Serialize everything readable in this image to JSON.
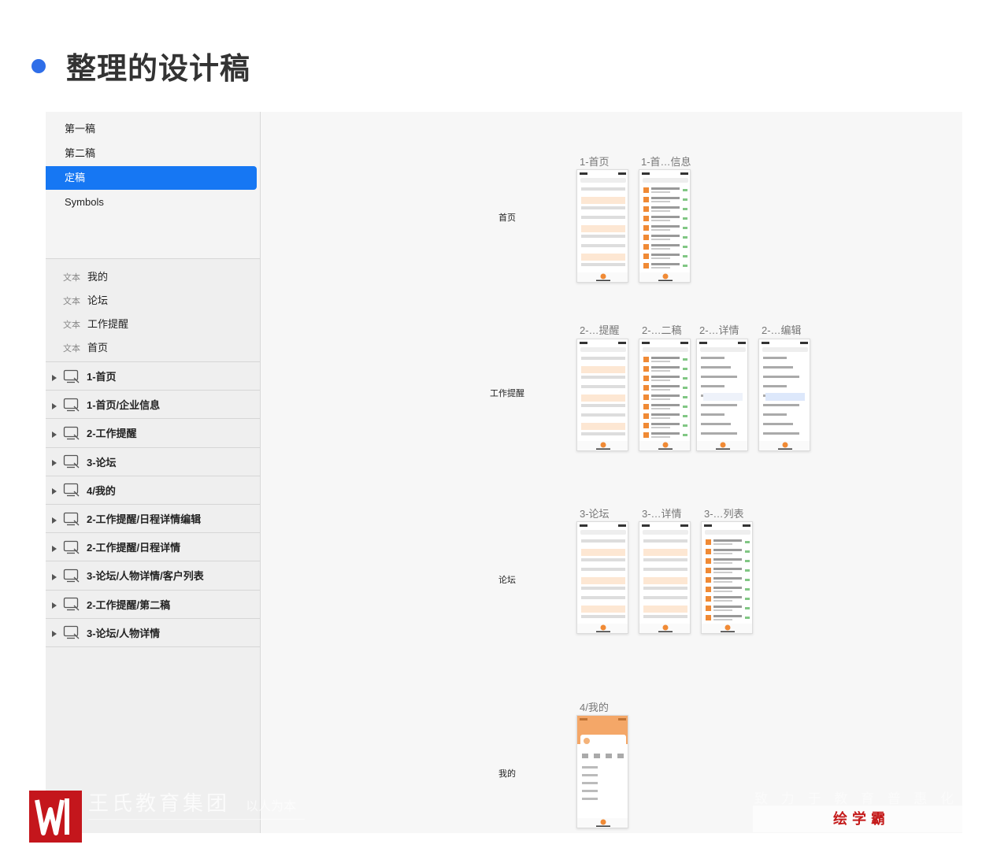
{
  "heading": "整理的设计稿",
  "sidebar": {
    "pages": [
      "第一稿",
      "第二稿",
      "定稿",
      "Symbols"
    ],
    "selected_page": "定稿",
    "text_layers": [
      {
        "kind": "文本",
        "label": "我的"
      },
      {
        "kind": "文本",
        "label": "论坛"
      },
      {
        "kind": "文本",
        "label": "工作提醒"
      },
      {
        "kind": "文本",
        "label": "首页"
      }
    ],
    "artboards": [
      "1-首页",
      "1-首页/企业信息",
      "2-工作提醒",
      "3-论坛",
      "4/我的",
      "2-工作提醒/日程详情编辑",
      "2-工作提醒/日程详情",
      "3-论坛/人物详情/客户列表",
      "2-工作提醒/第二稿",
      "3-论坛/人物详情"
    ]
  },
  "canvas": {
    "groups": [
      {
        "label": "首页",
        "artboards": [
          "1-首页",
          "1-首…信息"
        ]
      },
      {
        "label": "工作提醒",
        "artboards": [
          "2-…提醒",
          "2-…二稿",
          "2-…详情",
          "2-…编辑"
        ]
      },
      {
        "label": "论坛",
        "artboards": [
          "3-论坛",
          "3-…详情",
          "3-…列表"
        ]
      },
      {
        "label": "我的",
        "artboards": [
          "4/我的"
        ]
      }
    ]
  },
  "watermark": {
    "org": "王氏教育集团",
    "slogan": "以人为本",
    "right_text": "致 力 于 教 育 普 惠 化 教",
    "brand": "绘学霸"
  },
  "colors": {
    "accent": "#1677f3",
    "title_dot": "#2f6ee8",
    "brand_red": "#c41a1a",
    "ui_orange": "#f08a35"
  }
}
